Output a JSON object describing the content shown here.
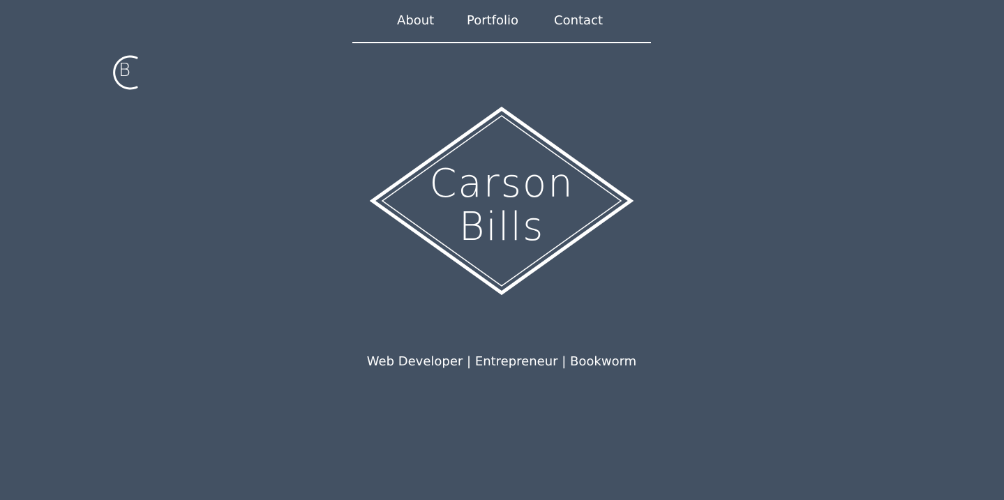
{
  "colors": {
    "background": "#435163",
    "foreground": "#ffffff"
  },
  "nav": {
    "items": [
      {
        "label": "About"
      },
      {
        "label": "Portfolio"
      },
      {
        "label": "Contact"
      }
    ]
  },
  "corner_logo": {
    "letter": "B",
    "icon": "cb-monogram-icon"
  },
  "hero": {
    "first_name": "Carson",
    "last_name": "Bills",
    "tagline": "Web Developer | Entrepreneur | Bookworm"
  }
}
